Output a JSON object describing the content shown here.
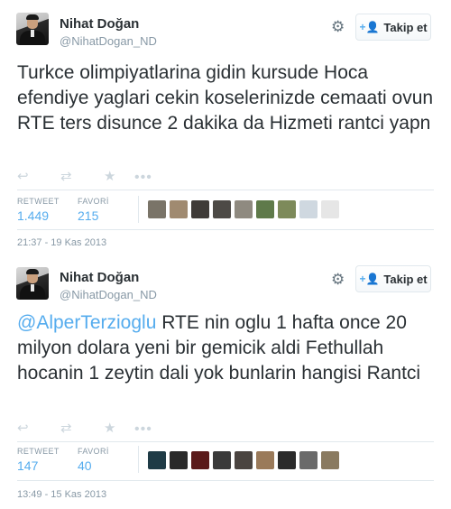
{
  "tweets": [
    {
      "author_name": "Nihat Doğan",
      "author_handle": "@NihatDogan_ND",
      "follow_label": "Takip et",
      "text": "Turkce olimpiyatlarina gidin kursude Hoca efendiye yaglari cekin koselerinizde cemaati ovun RTE ters disunce 2 dakika da Hizmeti rantci yapn",
      "mention": "",
      "retweet_label": "RETWEET",
      "retweet_count": "1.449",
      "favorite_label": "FAVORİ",
      "favorite_count": "215",
      "timestamp": "21:37 - 19 Kas 2013",
      "thumb_colors": [
        "#7a7468",
        "#a08a70",
        "#3f3b38",
        "#4d4a46",
        "#8f8a80",
        "#5f7a4a",
        "#7d8a5a",
        "#cfd8e0",
        "#e6e6e6"
      ]
    },
    {
      "author_name": "Nihat Doğan",
      "author_handle": "@NihatDogan_ND",
      "follow_label": "Takip et",
      "text": "RTE nin oglu 1 hafta once 20 milyon dolara yeni bir gemicik aldi Fethullah hocanin 1 zeytin dali yok bunlarin hangisi Rantci",
      "mention": "@AlperTerzioglu",
      "retweet_label": "RETWEET",
      "retweet_count": "147",
      "favorite_label": "FAVORİ",
      "favorite_count": "40",
      "timestamp": "13:49 - 15 Kas 2013",
      "thumb_colors": [
        "#1f3b46",
        "#2a2a2a",
        "#5a1a1a",
        "#3a3a3a",
        "#4a4440",
        "#9a7a5a",
        "#2b2b2b",
        "#6a6a6a",
        "#8a7a60"
      ]
    }
  ],
  "icons": {
    "gear": "gear-icon",
    "follow": "person-plus-icon",
    "reply": "reply-icon",
    "retweet": "retweet-icon",
    "favorite": "star-icon",
    "more": "more-dots-icon"
  },
  "colors": {
    "accent": "#55acee",
    "text": "#292f33",
    "muted": "#8899a6",
    "icon": "#ccd6dd",
    "divider": "#e1e8ed"
  }
}
